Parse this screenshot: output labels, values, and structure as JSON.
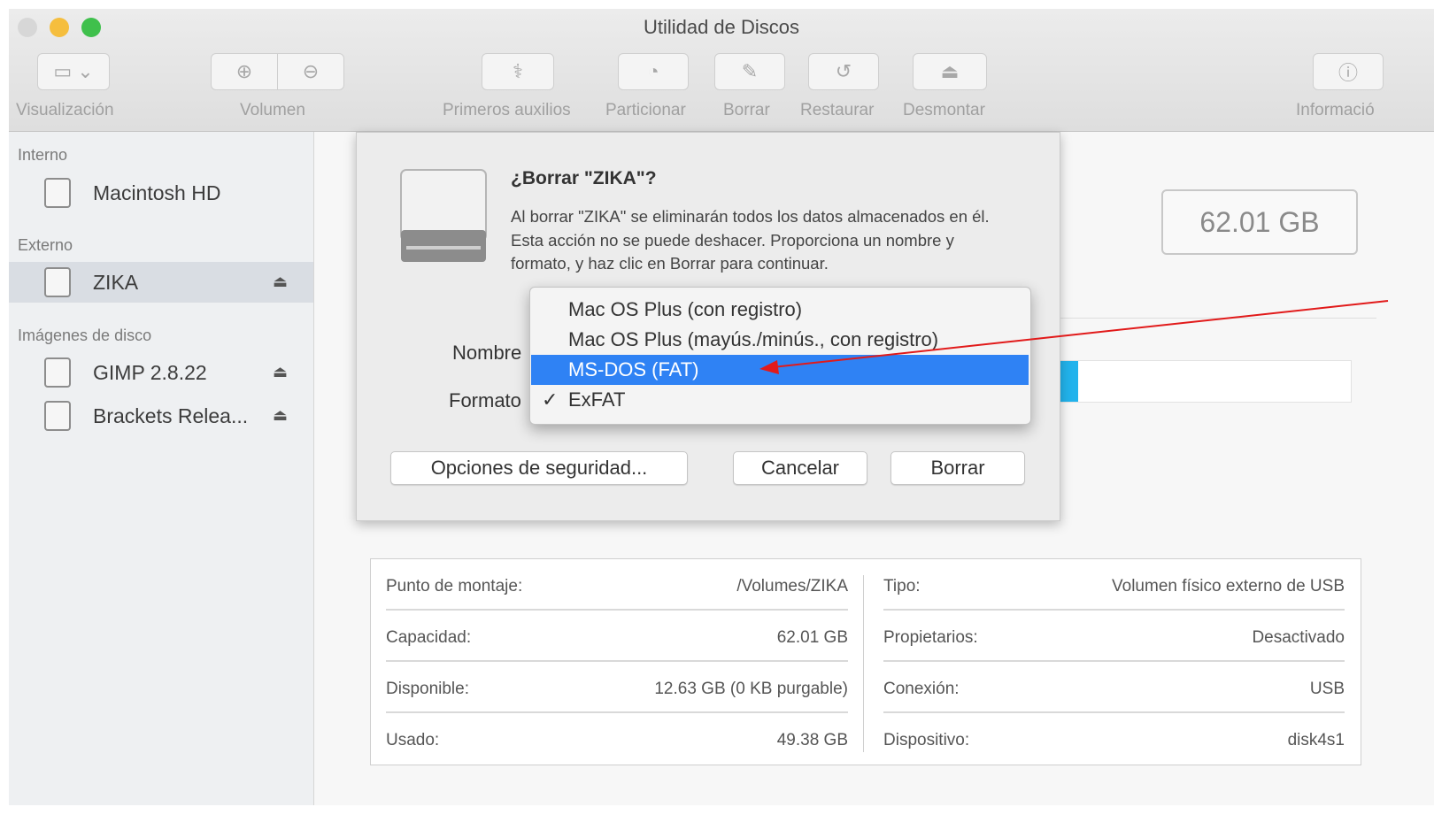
{
  "window": {
    "title": "Utilidad de Discos"
  },
  "toolbar": {
    "items": [
      {
        "label": "Visualización",
        "icon": "sidebar-toggle-icon"
      },
      {
        "label": "Volumen",
        "icon": "add-remove-volume-icon"
      },
      {
        "label": "Primeros auxilios",
        "icon": "stethoscope-icon"
      },
      {
        "label": "Particionar",
        "icon": "partition-icon"
      },
      {
        "label": "Borrar",
        "icon": "erase-icon"
      },
      {
        "label": "Restaurar",
        "icon": "restore-icon"
      },
      {
        "label": "Desmontar",
        "icon": "unmount-icon"
      },
      {
        "label": "Informació",
        "icon": "info-icon"
      }
    ]
  },
  "sidebar": {
    "sections": [
      "Interno",
      "Externo",
      "Imágenes de disco"
    ],
    "items": [
      {
        "label": "Macintosh HD"
      },
      {
        "label": "ZIKA",
        "eject": "⏏"
      },
      {
        "label": "GIMP 2.8.22",
        "eject": "⏏"
      },
      {
        "label": "Brackets Relea...",
        "eject": "⏏"
      }
    ]
  },
  "main": {
    "capacity_box": "62.01 GB",
    "usage_fraction": 0.2,
    "usage_color": "#22b3ec",
    "info_left": [
      {
        "key": "Punto de montaje:",
        "value": "/Volumes/ZIKA"
      },
      {
        "key": "Capacidad:",
        "value": "62.01 GB"
      },
      {
        "key": "Disponible:",
        "value": "12.63 GB (0 KB purgable)"
      },
      {
        "key": "Usado:",
        "value": "49.38 GB"
      }
    ],
    "info_right": [
      {
        "key": "Tipo:",
        "value": "Volumen físico externo de USB"
      },
      {
        "key": "Propietarios:",
        "value": "Desactivado"
      },
      {
        "key": "Conexión:",
        "value": "USB"
      },
      {
        "key": "Dispositivo:",
        "value": "disk4s1"
      }
    ]
  },
  "dialog": {
    "title": "¿Borrar \"ZIKA\"?",
    "message": "Al borrar \"ZIKA\" se eliminarán todos los datos almacenados en él. Esta acción no se puede deshacer. Proporciona un nombre y formato, y haz clic en Borrar para continuar.",
    "name_label": "Nombre",
    "format_label": "Formato",
    "buttons": {
      "security": "Opciones de seguridad...",
      "cancel": "Cancelar",
      "erase": "Borrar"
    },
    "format_menu": {
      "options": [
        "Mac OS Plus (con registro)",
        "Mac OS Plus (mayús./minús., con registro)",
        "MS-DOS (FAT)",
        "ExFAT"
      ],
      "highlighted": "MS-DOS (FAT)",
      "checked": "ExFAT",
      "check_mark": "✓",
      "highlight_color": "#2f82f4"
    }
  },
  "annotation": {
    "arrow_color": "#e11a1a"
  }
}
